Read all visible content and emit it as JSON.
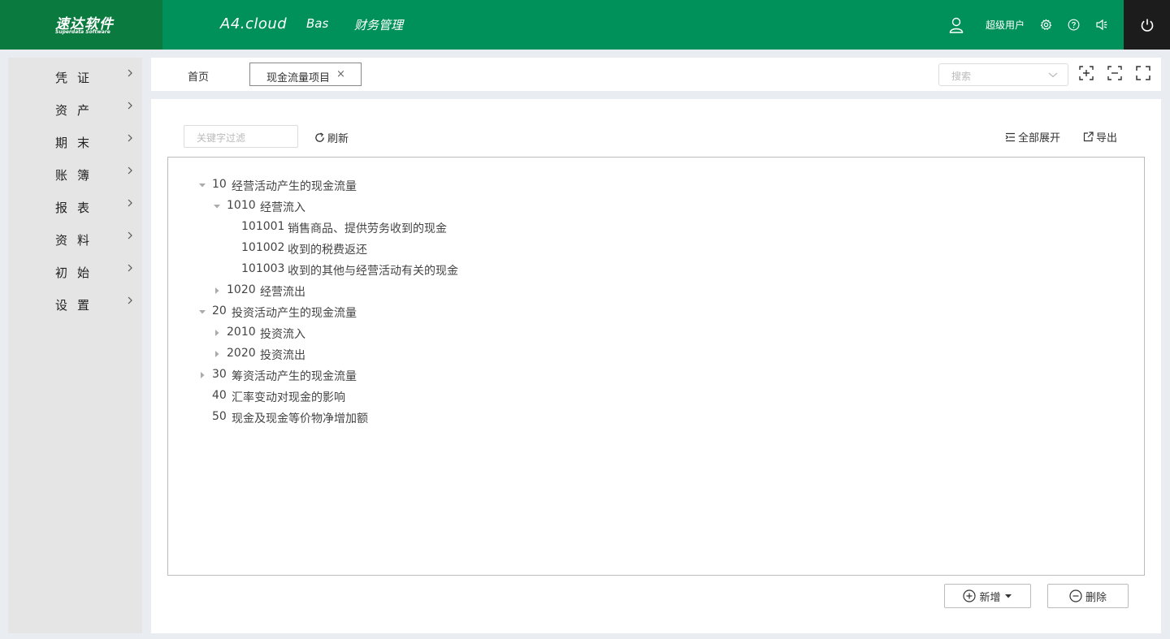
{
  "header": {
    "logo_cn": "速达软件",
    "logo_en": "Superdata Software",
    "brand": "A4.cloud",
    "nav_bas": "Bas",
    "nav_fin": "财务管理",
    "user_name": "超级用户"
  },
  "sidebar": {
    "items": [
      {
        "label": "凭证"
      },
      {
        "label": "资产"
      },
      {
        "label": "期末"
      },
      {
        "label": "账簿"
      },
      {
        "label": "报表"
      },
      {
        "label": "资料"
      },
      {
        "label": "初始"
      },
      {
        "label": "设置"
      }
    ]
  },
  "tabs": {
    "home": "首页",
    "active": "现金流量项目",
    "close": "×"
  },
  "search": {
    "placeholder": "搜索"
  },
  "toolbar": {
    "filter_placeholder": "关键字过滤",
    "refresh": "刷新",
    "expand_all": "全部展开",
    "export": "导出"
  },
  "tree": [
    {
      "code": "10",
      "name": "经营活动产生的现金流量",
      "level": 0,
      "state": "expanded"
    },
    {
      "code": "1010",
      "name": "经营流入",
      "level": 1,
      "state": "expanded"
    },
    {
      "code": "101001",
      "name": "销售商品、提供劳务收到的现金",
      "level": 2,
      "state": "leaf"
    },
    {
      "code": "101002",
      "name": "收到的税费返还",
      "level": 2,
      "state": "leaf"
    },
    {
      "code": "101003",
      "name": "收到的其他与经营活动有关的现金",
      "level": 2,
      "state": "leaf"
    },
    {
      "code": "1020",
      "name": "经营流出",
      "level": 1,
      "state": "collapsed"
    },
    {
      "code": "20",
      "name": "投资活动产生的现金流量",
      "level": 0,
      "state": "expanded"
    },
    {
      "code": "2010",
      "name": "投资流入",
      "level": 1,
      "state": "collapsed"
    },
    {
      "code": "2020",
      "name": "投资流出",
      "level": 1,
      "state": "collapsed"
    },
    {
      "code": "30",
      "name": "筹资活动产生的现金流量",
      "level": 0,
      "state": "collapsed"
    },
    {
      "code": "40",
      "name": "汇率变动对现金的影响",
      "level": 0,
      "state": "leaf"
    },
    {
      "code": "50",
      "name": "现金及现金等价物净增加额",
      "level": 0,
      "state": "leaf"
    }
  ],
  "actions": {
    "add": "新增",
    "delete": "删除"
  }
}
